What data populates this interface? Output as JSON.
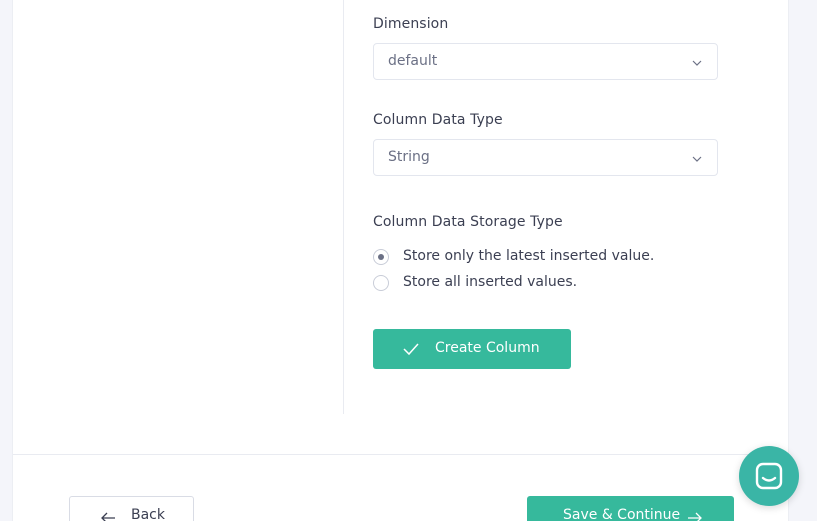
{
  "form": {
    "dimension_label": "Dimension",
    "dimension_value": "default",
    "data_type_label": "Column Data Type",
    "data_type_value": "String",
    "storage_type_label": "Column Data Storage Type",
    "storage_options": [
      {
        "label": "Store only the latest inserted value.",
        "selected": true
      },
      {
        "label": "Store all inserted values.",
        "selected": false
      }
    ],
    "create_button_label": "Create Column"
  },
  "footer": {
    "back_label": "Back",
    "save_label": "Save & Continue"
  },
  "colors": {
    "accent": "#36b99c",
    "chat": "#3ab5a6"
  },
  "icons": {
    "select_chevron": "chevron-down-icon",
    "create": "check-icon",
    "back": "arrow-left-icon",
    "save": "arrow-right-icon",
    "chat": "chat-icon"
  }
}
